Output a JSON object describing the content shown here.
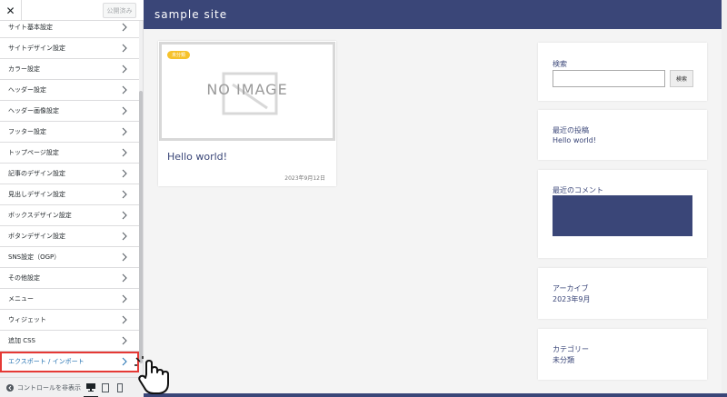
{
  "customizer": {
    "close_icon": "close-icon",
    "publish_label": "公開済み",
    "menu_items": [
      {
        "label": "サイト基本設定"
      },
      {
        "label": "サイトデザイン設定"
      },
      {
        "label": "カラー設定"
      },
      {
        "label": "ヘッダー設定"
      },
      {
        "label": "ヘッダー画像設定"
      },
      {
        "label": "フッター設定"
      },
      {
        "label": "トップページ設定"
      },
      {
        "label": "記事のデザイン設定"
      },
      {
        "label": "見出しデザイン設定"
      },
      {
        "label": "ボックスデザイン設定"
      },
      {
        "label": "ボタンデザイン設定"
      },
      {
        "label": "SNS設定（OGP）"
      },
      {
        "label": "その他設定"
      },
      {
        "label": "メニュー"
      },
      {
        "label": "ウィジェット"
      },
      {
        "label": "追加 CSS"
      },
      {
        "label": "エクスポート / インポート",
        "active": true
      }
    ],
    "footer": {
      "hide_controls_label": "コントロールを非表示"
    }
  },
  "preview": {
    "site_title": "sample site",
    "post": {
      "thumbnail_text": "NO IMAGE",
      "category_badge": "未分類",
      "title": "Hello world!",
      "date": "2023年9月12日"
    },
    "widgets": {
      "search": {
        "heading": "検索",
        "button_label": "検索"
      },
      "recent_posts": {
        "heading": "最近の投稿",
        "item": "Hello world!"
      },
      "recent_comments": {
        "heading": "最近のコメント"
      },
      "archives": {
        "heading": "アーカイブ",
        "item": "2023年9月"
      },
      "categories": {
        "heading": "カテゴリー",
        "item": "未分類"
      }
    }
  },
  "colors": {
    "brand": "#3a4678",
    "badge": "#f6c22b",
    "highlight": "#e53935"
  }
}
